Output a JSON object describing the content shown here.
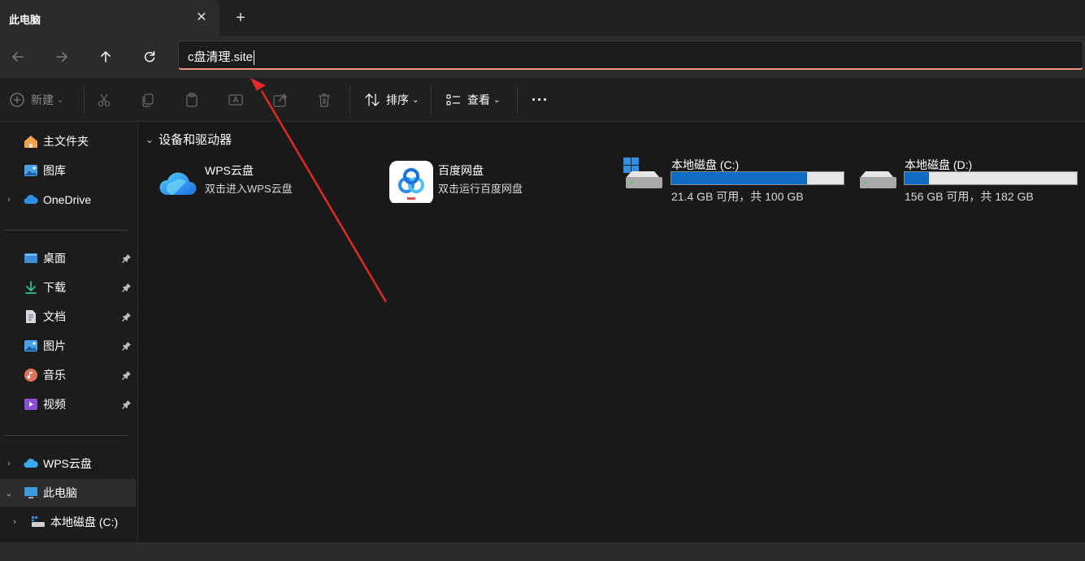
{
  "tab": {
    "title": "此电脑",
    "close_glyph": "✕",
    "new_glyph": "+"
  },
  "address": {
    "value": "c盘清理.site"
  },
  "toolbar": {
    "new_label": "新建",
    "sort_label": "排序",
    "view_label": "查看",
    "more_glyph": "···"
  },
  "sidebar": {
    "home": "主文件夹",
    "gallery": "图库",
    "onedrive": "OneDrive",
    "desktop": "桌面",
    "downloads": "下载",
    "documents": "文档",
    "pictures": "图片",
    "music": "音乐",
    "videos": "视频",
    "wps": "WPS云盘",
    "thispc": "此电脑",
    "local_c": "本地磁盘 (C:)"
  },
  "content": {
    "section_title": "设备和驱动器",
    "wps": {
      "name": "WPS云盘",
      "sub": "双击进入WPS云盘"
    },
    "baidu": {
      "name": "百度网盘",
      "sub": "双击运行百度网盘"
    },
    "drive_c": {
      "name": "本地磁盘 (C:)",
      "free_text": "21.4 GB 可用，共 100 GB",
      "used_fraction": 0.786
    },
    "drive_d": {
      "name": "本地磁盘 (D:)",
      "free_text": "156 GB 可用，共 182 GB",
      "used_fraction": 0.143
    }
  },
  "colors": {
    "accent_underline": "#f0957a",
    "drive_bar_fill": "#0f6cc5",
    "annotation_arrow": "#e02a25"
  }
}
